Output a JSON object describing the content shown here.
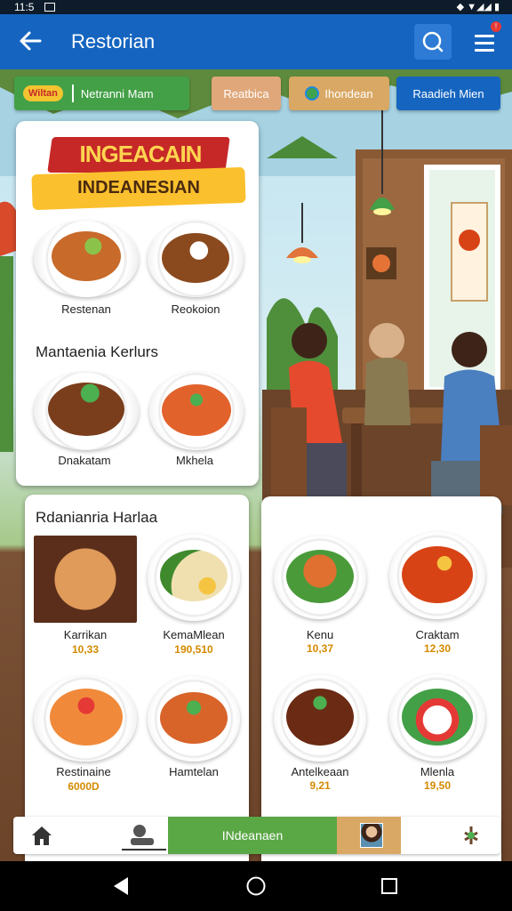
{
  "status": {
    "time": "11:5"
  },
  "appbar": {
    "title": "Restorian",
    "notif_count": "!"
  },
  "chips": [
    {
      "label": "Netranni Mam",
      "logo_text": "Wiltan"
    },
    {
      "label": "Reatbica"
    },
    {
      "label": "Ihondean"
    },
    {
      "label": "Raadieh Mien"
    }
  ],
  "banner": {
    "line1": "INGEACAIN",
    "line2": "INDEANESIAN"
  },
  "card1": {
    "items": [
      {
        "name": "Restenan"
      },
      {
        "name": "Reokoion"
      }
    ],
    "section": "Mantaenia Kerlurs",
    "items2": [
      {
        "name": "Dnakatam"
      },
      {
        "name": "Mkhela"
      }
    ]
  },
  "card2": {
    "section": "Rdanianria Harlaa",
    "items": [
      {
        "name": "Karrikan",
        "price": "10,33"
      },
      {
        "name": "KemaMlean",
        "price": "190,510"
      },
      {
        "name": "Restinaine",
        "price": "6000D"
      },
      {
        "name": "Hamtelan",
        "price": ""
      }
    ]
  },
  "card3": {
    "items": [
      {
        "name": "Kenu",
        "price": "10,37"
      },
      {
        "name": "Craktam",
        "price": "12,30"
      },
      {
        "name": "Antelkeaan",
        "price": "9,21"
      },
      {
        "name": "Mlenla",
        "price": "19,50"
      }
    ]
  },
  "bottombar": {
    "center_label": "INdeanaen"
  },
  "colors": {
    "appbar": "#1565c0",
    "chip_green": "#43a047",
    "chip_tan": "#e0a87a",
    "chip_gold": "#d9a864",
    "chip_blue": "#1565c0",
    "price": "#d48a00"
  }
}
